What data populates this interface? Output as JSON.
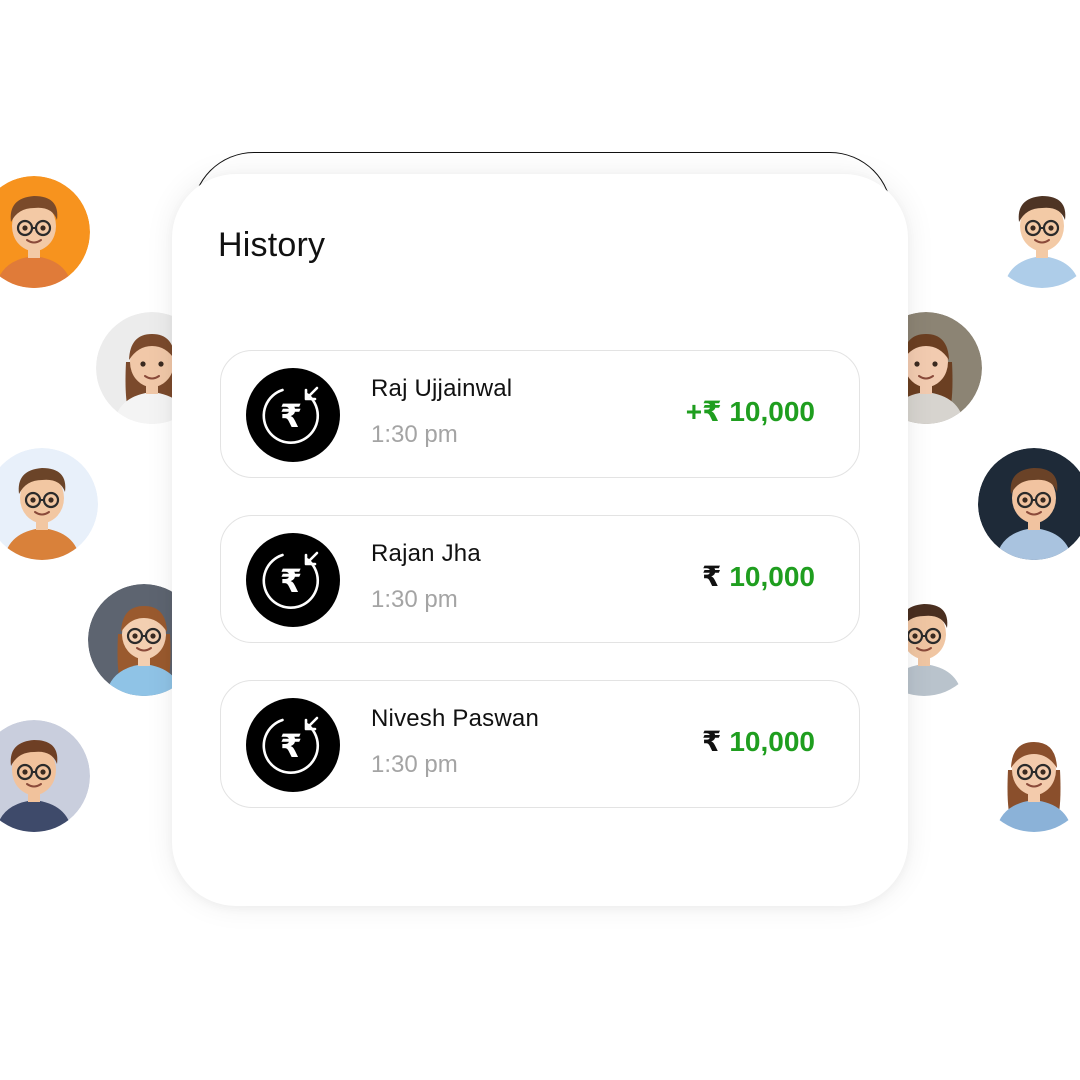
{
  "history": {
    "title": "History",
    "transactions": [
      {
        "name": "Raj Ujjainwal",
        "time": "1:30 pm",
        "sign": "+",
        "currency": "₹",
        "amount": "10,000",
        "currency_style": "green"
      },
      {
        "name": "Rajan Jha",
        "time": "1:30 pm",
        "sign": "",
        "currency": "₹",
        "amount": "10,000",
        "currency_style": "dark"
      },
      {
        "name": "Nivesh Paswan",
        "time": "1:30 pm",
        "sign": "",
        "currency": "₹",
        "amount": "10,000",
        "currency_style": "dark"
      }
    ]
  },
  "icons": {
    "transaction": "rupee-receive-icon"
  },
  "colors": {
    "amount_green": "#1f9e1f",
    "icon_bg": "#000000",
    "time_gray": "#a4a4a4",
    "card_border": "#e3e3e3"
  },
  "avatars": [
    {
      "name": "avatar-boy-orange",
      "bg": "#f7931e",
      "skin": "#f3c9a5",
      "hair": "#7a4a2a",
      "shirt": "#e07b39",
      "glasses": true,
      "long_hair": false
    },
    {
      "name": "avatar-girl-labcoat",
      "bg": "#ececec",
      "skin": "#f1c8a8",
      "hair": "#7b4a2c",
      "shirt": "#f4f4f4",
      "glasses": false,
      "long_hair": true
    },
    {
      "name": "avatar-boy-blue",
      "bg": "#e8f0fa",
      "skin": "#f2c7a2",
      "hair": "#6b4428",
      "shirt": "#d9813a",
      "glasses": true,
      "long_hair": false
    },
    {
      "name": "avatar-girl-glasses",
      "bg": "#5d6470",
      "skin": "#f3cfb1",
      "hair": "#9a5a2e",
      "shirt": "#8fc3e6",
      "glasses": true,
      "long_hair": true
    },
    {
      "name": "avatar-boy-smile",
      "bg": "#c9cedd",
      "skin": "#f1c29c",
      "hair": "#6e3f24",
      "shirt": "#3e4a6a",
      "glasses": true,
      "long_hair": false
    },
    {
      "name": "avatar-boy-white",
      "bg": "#ffffff",
      "skin": "#f3caa6",
      "hair": "#4e3424",
      "shirt": "#aecde9",
      "glasses": true,
      "long_hair": false
    },
    {
      "name": "avatar-girl-phone",
      "bg": "#8c8474",
      "skin": "#f2cbb0",
      "hair": "#6b3f22",
      "shirt": "#d7d4cf",
      "glasses": false,
      "long_hair": true
    },
    {
      "name": "avatar-boy-dark",
      "bg": "#1e2a38",
      "skin": "#f1c3a0",
      "hair": "#6a4227",
      "shirt": "#a9c3df",
      "glasses": true,
      "long_hair": false
    },
    {
      "name": "avatar-boy-arms",
      "bg": "#ffffff",
      "skin": "#f0c6a3",
      "hair": "#4a2f20",
      "shirt": "#b9c3cc",
      "glasses": true,
      "long_hair": false
    },
    {
      "name": "avatar-girl-book",
      "bg": "#ffffff",
      "skin": "#f3cbac",
      "hair": "#8a4f2c",
      "shirt": "#8bb2d8",
      "glasses": true,
      "long_hair": true
    }
  ]
}
